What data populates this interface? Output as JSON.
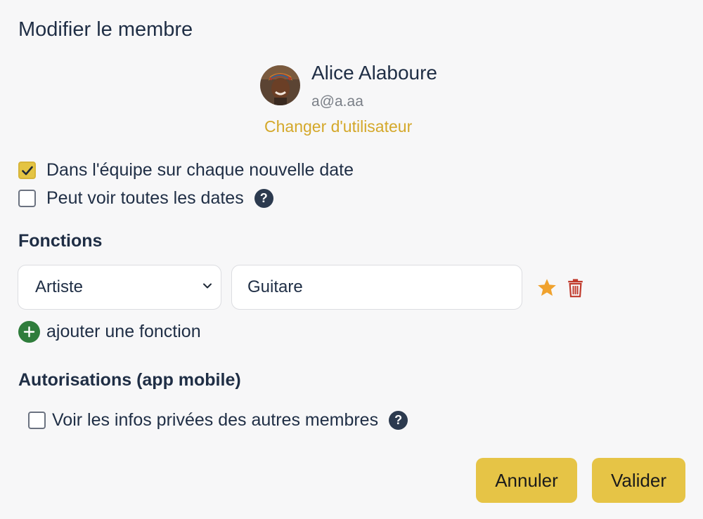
{
  "dialog": {
    "title": "Modifier le membre"
  },
  "member": {
    "name": "Alice Alaboure",
    "email": "a@a.aa",
    "change_user_label": "Changer d'utilisateur"
  },
  "options": [
    {
      "label": "Dans l'équipe sur chaque nouvelle date",
      "checked": true
    },
    {
      "label": "Peut voir toutes les dates",
      "checked": false,
      "help": "?"
    }
  ],
  "functions": {
    "heading": "Fonctions",
    "rows": [
      {
        "role": "Artiste",
        "instrument": "Guitare"
      }
    ],
    "add_label": "ajouter une fonction"
  },
  "permissions": {
    "heading": "Autorisations (app mobile)",
    "items": [
      {
        "label": "Voir les infos privées des autres membres",
        "checked": false,
        "help": "?"
      }
    ]
  },
  "actions": {
    "cancel_label": "Annuler",
    "submit_label": "Valider"
  },
  "colors": {
    "accent": "#e6c446",
    "link": "#d4a82a",
    "add_green": "#2f7d3c",
    "star": "#f0a22e",
    "trash": "#c0392b"
  }
}
